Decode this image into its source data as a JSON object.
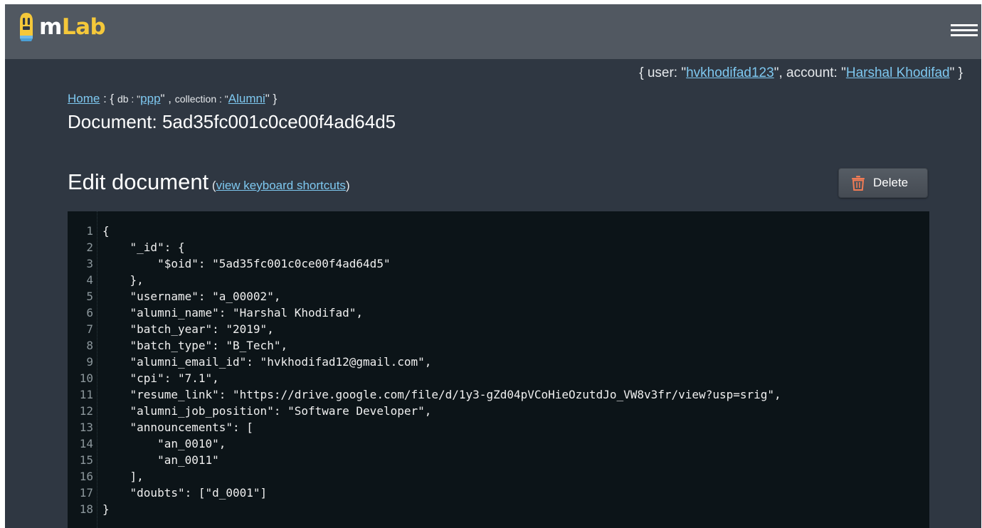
{
  "app": {
    "logo_m": "m",
    "logo_lab": "Lab",
    "brand_color": "#f5c83a"
  },
  "user_info": {
    "prefix": "{ user: \"",
    "user": "hvkhodifad123",
    "middle": "\", account: \"",
    "account": "Harshal Khodifad",
    "suffix": "\" }"
  },
  "breadcrumb": {
    "home": "Home",
    "sep1": " : { ",
    "db_key": "db : \"",
    "db": "ppp",
    "sep2": "\" , ",
    "collection_key": "collection : \"",
    "collection": "Alumni",
    "end": "\" }"
  },
  "document": {
    "title": "Document: 5ad35fc001c0ce00f4ad64d5"
  },
  "editor": {
    "heading": "Edit document",
    "shortcuts_open": " (",
    "shortcuts_link": "view keyboard shortcuts",
    "shortcuts_close": ")",
    "delete_label": "Delete",
    "lines": [
      {
        "n": "1",
        "text": "{"
      },
      {
        "n": "2",
        "text": "    \"_id\": {"
      },
      {
        "n": "3",
        "text": "        \"$oid\": \"5ad35fc001c0ce00f4ad64d5\""
      },
      {
        "n": "4",
        "text": "    },"
      },
      {
        "n": "5",
        "text": "    \"username\": \"a_00002\","
      },
      {
        "n": "6",
        "text": "    \"alumni_name\": \"Harshal Khodifad\","
      },
      {
        "n": "7",
        "text": "    \"batch_year\": \"2019\","
      },
      {
        "n": "8",
        "text": "    \"batch_type\": \"B_Tech\","
      },
      {
        "n": "9",
        "text": "    \"alumni_email_id\": \"hvkhodifad12@gmail.com\","
      },
      {
        "n": "10",
        "text": "    \"cpi\": \"7.1\","
      },
      {
        "n": "11",
        "text": "    \"resume_link\": \"https://drive.google.com/file/d/1y3-gZd04pVCoHieOzutdJo_VW8v3fr/view?usp=srig\","
      },
      {
        "n": "12",
        "text": "    \"alumni_job_position\": \"Software Developer\","
      },
      {
        "n": "13",
        "text": "    \"announcements\": ["
      },
      {
        "n": "14",
        "text": "        \"an_0010\","
      },
      {
        "n": "15",
        "text": "        \"an_0011\""
      },
      {
        "n": "16",
        "text": "    ],"
      },
      {
        "n": "17",
        "text": "    \"doubts\": [\"d_0001\"]"
      },
      {
        "n": "18",
        "text": "}"
      }
    ]
  }
}
